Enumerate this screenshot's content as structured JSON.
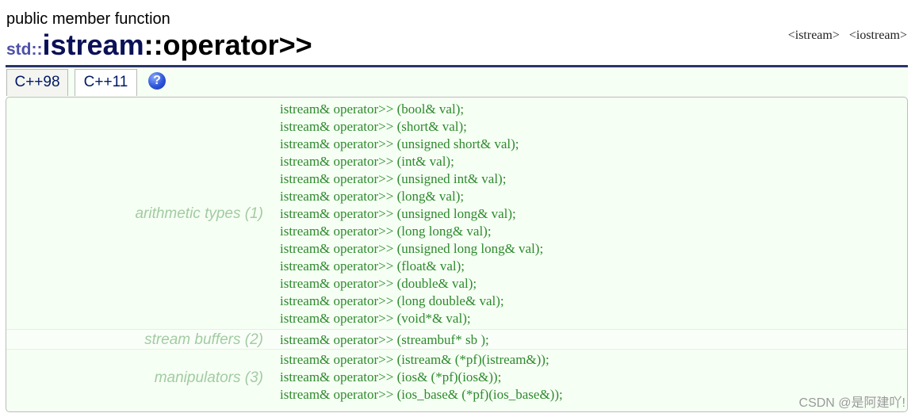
{
  "header": {
    "kind": "public member function",
    "namespace": "std::",
    "class_name": "istream",
    "member": "::operator>>",
    "headers": [
      "<istream>",
      "<iostream>"
    ]
  },
  "tabs": [
    {
      "label": "C++98"
    },
    {
      "label": "C++11"
    }
  ],
  "help_icon": "?",
  "groups": [
    {
      "label": "arithmetic types (1)",
      "declarations": [
        "istream& operator>> (bool& val);",
        "istream& operator>> (short& val);",
        "istream& operator>> (unsigned short& val);",
        "istream& operator>> (int& val);",
        "istream& operator>> (unsigned int& val);",
        "istream& operator>> (long& val);",
        "istream& operator>> (unsigned long& val);",
        "istream& operator>> (long long& val);",
        "istream& operator>> (unsigned long long& val);",
        "istream& operator>> (float& val);",
        "istream& operator>> (double& val);",
        "istream& operator>> (long double& val);",
        "istream& operator>> (void*& val);"
      ]
    },
    {
      "label": "stream buffers (2)",
      "declarations": [
        "istream& operator>> (streambuf* sb );"
      ]
    },
    {
      "label": "manipulators (3)",
      "declarations": [
        "istream& operator>> (istream& (*pf)(istream&));",
        "istream& operator>> (ios& (*pf)(ios&));",
        "istream& operator>> (ios_base& (*pf)(ios_base&));"
      ]
    }
  ],
  "watermark": "CSDN @是阿建吖!"
}
